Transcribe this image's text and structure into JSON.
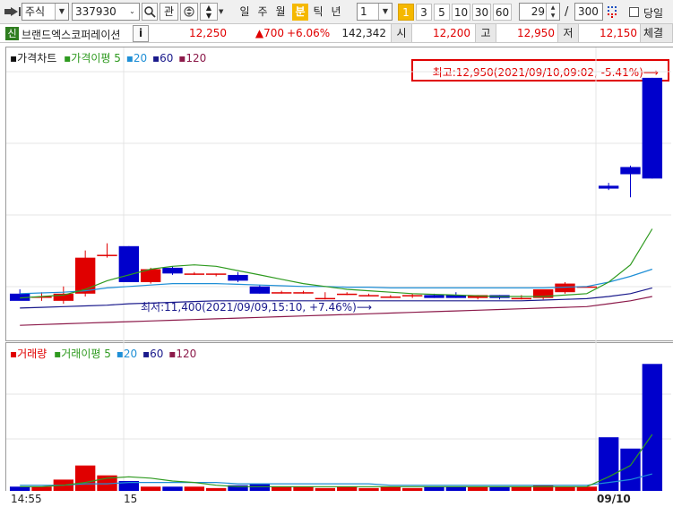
{
  "toolbar": {
    "market": "주식",
    "code": "337930",
    "btn_gwan": "관",
    "periods": [
      "일",
      "주",
      "월",
      "분",
      "틱",
      "년"
    ],
    "selected_period": "분",
    "interval": "1",
    "intervals": [
      "1",
      "3",
      "5",
      "10",
      "30",
      "60"
    ],
    "selected_interval": "1",
    "display_count": "29",
    "slash": "/",
    "total_count": "300",
    "same_day_label": "당일"
  },
  "quote": {
    "credit_badge": "신",
    "name": "브랜드엑스코퍼레이션",
    "info_btn": "i",
    "price": "12,250",
    "change": "▲700",
    "change_rate": "+6.06%",
    "volume": "142,342",
    "open_label": "시",
    "open": "12,200",
    "high_label": "고",
    "high": "12,950",
    "low_label": "저",
    "low": "12,150",
    "exec_label": "체결강"
  },
  "price_panel": {
    "legend_price": "가격차트",
    "legend_ma": "가격이평",
    "ma_periods": [
      "5",
      "20",
      "60",
      "120"
    ],
    "high_annotation": "최고:12,950(2021/09/10,09:02, -5.41%)⟶",
    "low_annotation": "최저:11,400(2021/09/09,15:10, +7.46%)⟶"
  },
  "volume_panel": {
    "legend_volume": "거래량",
    "legend_ma": "거래이평",
    "ma_periods": [
      "5",
      "20",
      "60",
      "120"
    ]
  },
  "x_axis": {
    "labels": [
      "14:55",
      "15",
      "09/10"
    ]
  },
  "colors": {
    "up": "#e00000",
    "down": "#0000cc",
    "ma5": "#2e9a1f",
    "ma20": "#1f8fd6",
    "ma60": "#1a1a8c",
    "ma120": "#8c1a4a",
    "highlight": "#f5b800"
  },
  "chart_data": {
    "type": "candlestick",
    "candles": [
      {
        "open": 11450,
        "high": 11480,
        "low": 11430,
        "close": 11400
      },
      {
        "open": 11430,
        "high": 11460,
        "low": 11400,
        "close": 11430
      },
      {
        "open": 11400,
        "high": 11500,
        "low": 11380,
        "close": 11450
      },
      {
        "open": 11450,
        "high": 11750,
        "low": 11430,
        "close": 11700
      },
      {
        "open": 11720,
        "high": 11800,
        "low": 11700,
        "close": 11720
      },
      {
        "open": 11780,
        "high": 11780,
        "low": 11530,
        "close": 11530
      },
      {
        "open": 11530,
        "high": 11630,
        "low": 11520,
        "close": 11620
      },
      {
        "open": 11630,
        "high": 11640,
        "low": 11580,
        "close": 11590
      },
      {
        "open": 11590,
        "high": 11600,
        "low": 11580,
        "close": 11590
      },
      {
        "open": 11590,
        "high": 11590,
        "low": 11570,
        "close": 11590
      },
      {
        "open": 11580,
        "high": 11600,
        "low": 11530,
        "close": 11540
      },
      {
        "open": 11500,
        "high": 11510,
        "low": 11450,
        "close": 11450
      },
      {
        "open": 11460,
        "high": 11470,
        "low": 11450,
        "close": 11460
      },
      {
        "open": 11460,
        "high": 11470,
        "low": 11450,
        "close": 11460
      },
      {
        "open": 11420,
        "high": 11460,
        "low": 11410,
        "close": 11420
      },
      {
        "open": 11450,
        "high": 11460,
        "low": 11440,
        "close": 11450
      },
      {
        "open": 11440,
        "high": 11450,
        "low": 11430,
        "close": 11440
      },
      {
        "open": 11430,
        "high": 11440,
        "low": 11420,
        "close": 11430
      },
      {
        "open": 11440,
        "high": 11450,
        "low": 11420,
        "close": 11440
      },
      {
        "open": 11440,
        "high": 11450,
        "low": 11420,
        "close": 11420
      },
      {
        "open": 11440,
        "high": 11460,
        "low": 11420,
        "close": 11420
      },
      {
        "open": 11420,
        "high": 11440,
        "low": 11410,
        "close": 11440
      },
      {
        "open": 11440,
        "high": 11440,
        "low": 11410,
        "close": 11420
      },
      {
        "open": 11420,
        "high": 11440,
        "low": 11410,
        "close": 11420
      },
      {
        "open": 11420,
        "high": 11480,
        "low": 11410,
        "close": 11480
      },
      {
        "open": 11460,
        "high": 11530,
        "low": 11450,
        "close": 11520
      },
      {
        "open": 11500,
        "high": 11500,
        "low": 11500,
        "close": 11500
      },
      {
        "open": 12200,
        "high": 12220,
        "low": 12170,
        "close": 12180
      },
      {
        "open": 12330,
        "high": 12340,
        "low": 12120,
        "close": 12280
      },
      {
        "open": 12950,
        "high": 12950,
        "low": 12250,
        "close": 12250
      }
    ],
    "volumes": [
      3,
      3,
      8,
      18,
      11,
      7,
      3,
      3,
      3,
      2,
      4,
      5,
      3,
      3,
      2,
      3,
      2,
      3,
      2,
      3,
      3,
      3,
      3,
      3,
      4,
      3,
      3,
      38,
      30,
      90
    ],
    "ma5": [
      11420,
      11430,
      11440,
      11480,
      11540,
      11580,
      11620,
      11640,
      11650,
      11640,
      11610,
      11580,
      11550,
      11520,
      11500,
      11480,
      11470,
      11460,
      11450,
      11445,
      11440,
      11435,
      11430,
      11430,
      11430,
      11440,
      11450,
      11530,
      11650,
      11900
    ],
    "ma20": [
      11450,
      11455,
      11460,
      11470,
      11490,
      11500,
      11510,
      11520,
      11520,
      11520,
      11515,
      11510,
      11505,
      11500,
      11500,
      11495,
      11495,
      11490,
      11490,
      11490,
      11490,
      11490,
      11490,
      11490,
      11490,
      11495,
      11500,
      11530,
      11570,
      11620
    ],
    "ma60": [
      11350,
      11355,
      11360,
      11365,
      11370,
      11380,
      11385,
      11390,
      11395,
      11400,
      11400,
      11400,
      11400,
      11400,
      11400,
      11400,
      11400,
      11400,
      11400,
      11400,
      11400,
      11400,
      11400,
      11400,
      11405,
      11410,
      11415,
      11430,
      11450,
      11490
    ],
    "ma120": [
      11230,
      11235,
      11240,
      11245,
      11250,
      11255,
      11260,
      11265,
      11270,
      11275,
      11280,
      11285,
      11290,
      11295,
      11300,
      11305,
      11310,
      11315,
      11320,
      11325,
      11330,
      11335,
      11340,
      11345,
      11350,
      11355,
      11360,
      11380,
      11400,
      11430
    ],
    "vol_ma5": [
      3,
      3,
      4,
      6,
      9,
      10,
      9,
      7,
      6,
      4,
      3,
      3,
      3,
      3,
      3,
      3,
      3,
      3,
      3,
      3,
      3,
      3,
      3,
      3,
      3,
      3,
      3,
      10,
      18,
      40
    ],
    "vol_ma20": [
      4,
      4,
      4,
      5,
      5,
      6,
      6,
      6,
      6,
      6,
      5,
      5,
      5,
      5,
      5,
      5,
      5,
      4,
      4,
      4,
      4,
      4,
      4,
      4,
      4,
      4,
      4,
      6,
      8,
      12
    ],
    "ylim_price": [
      11150,
      13080
    ],
    "ylim_volume": [
      0,
      94
    ]
  }
}
